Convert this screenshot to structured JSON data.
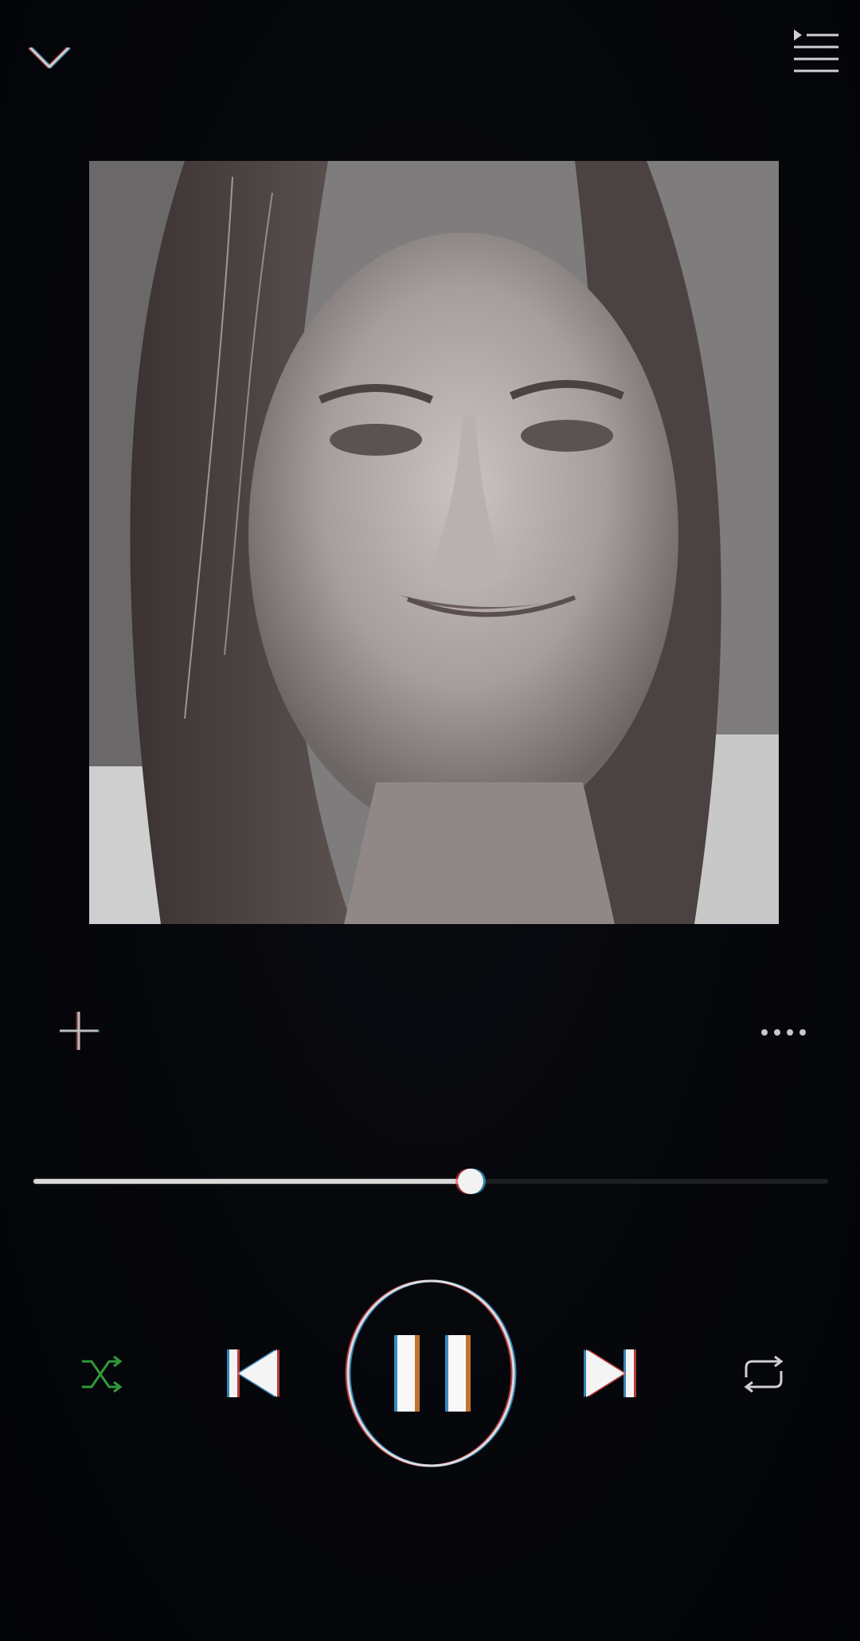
{
  "player": {
    "header": {
      "collapse_icon": "chevron-down-icon",
      "queue_icon": "queue-list-icon"
    },
    "album_art": {
      "description_icon": "album-cover-image"
    },
    "actions": {
      "add_icon": "plus-icon",
      "more_icon": "more-horizontal-icon"
    },
    "progress": {
      "fraction": 0.55
    },
    "controls": {
      "shuffle_icon": "shuffle-icon",
      "previous_icon": "skip-previous-icon",
      "play_pause_icon": "pause-icon",
      "next_icon": "skip-next-icon",
      "repeat_icon": "repeat-icon",
      "state": "playing"
    },
    "colors": {
      "background": "#05060a",
      "foreground": "#e6e6e6",
      "shuffle_active": "#2f9a3a",
      "track": "#1e1f24"
    }
  }
}
